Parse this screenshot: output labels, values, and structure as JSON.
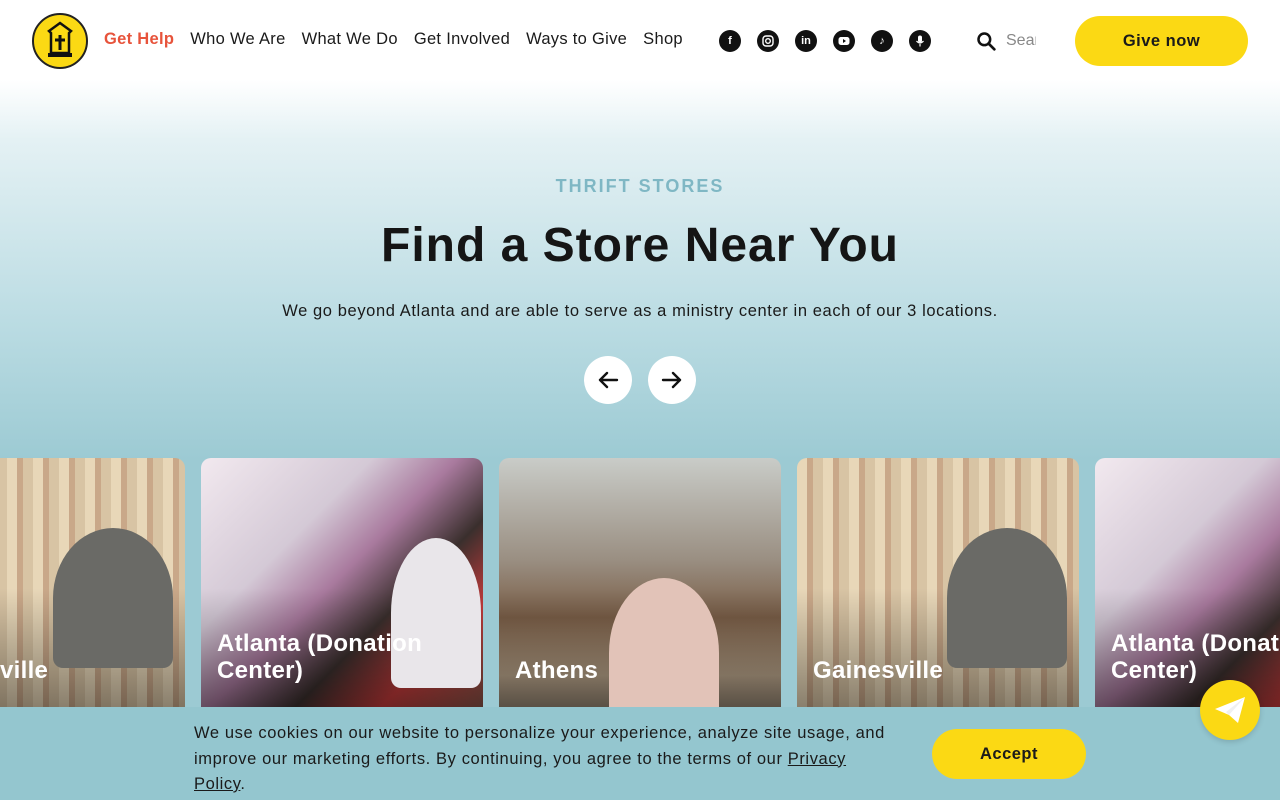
{
  "nav": {
    "items": [
      {
        "label": "Get Help",
        "active": true
      },
      {
        "label": "Who We Are"
      },
      {
        "label": "What We Do"
      },
      {
        "label": "Get Involved"
      },
      {
        "label": "Ways to Give"
      },
      {
        "label": "Shop"
      }
    ]
  },
  "socials": [
    "facebook-icon",
    "instagram-icon",
    "linkedin-icon",
    "youtube-icon",
    "tiktok-icon",
    "podcast-icon"
  ],
  "search": {
    "placeholder": "Search"
  },
  "header": {
    "give_label": "Give now"
  },
  "hero": {
    "eyebrow": "THRIFT STORES",
    "title": "Find a Store Near You",
    "subtitle": "We go beyond Atlanta and are able to serve as a ministry center in each of our 3 locations."
  },
  "cards": [
    {
      "label": "Gainesville",
      "visible_text": "ville"
    },
    {
      "label": "Atlanta (Donation\nCenter)"
    },
    {
      "label": "Athens"
    },
    {
      "label": "Gainesville"
    },
    {
      "label": "Atlanta (Donation\nCenter)"
    }
  ],
  "cookie": {
    "text": "We use cookies on our website to personalize your experience, analyze site usage, and improve our marketing efforts. By continuing, you agree to the terms of our ",
    "link": "Privacy Policy",
    "end": ".",
    "accept_label": "Accept"
  },
  "colors": {
    "accent": "#fbd914",
    "active_nav": "#e7533b",
    "eyebrow": "#7fb7c4",
    "cookie_bg": "#94c6cf"
  }
}
